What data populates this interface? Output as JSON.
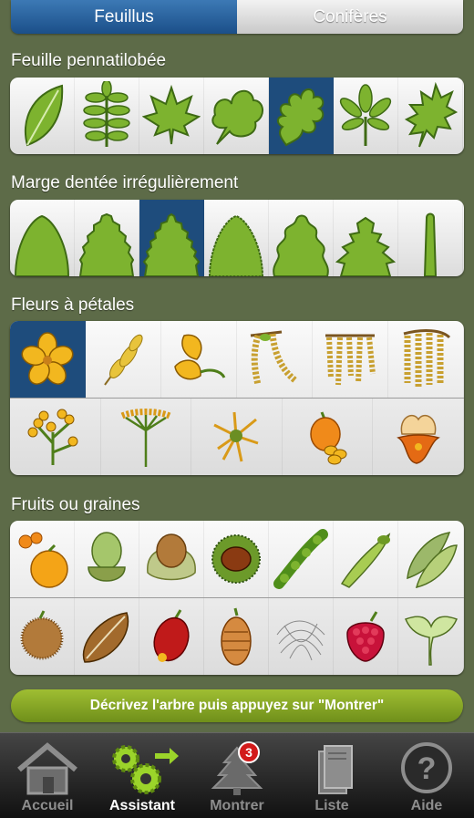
{
  "segments": {
    "left": "Feuillus",
    "right": "Conifères",
    "selected": "Feuillus"
  },
  "sections": [
    {
      "title": "Feuille pennatilobée"
    },
    {
      "title": "Marge dentée irrégulièrement"
    },
    {
      "title": "Fleurs à pétales"
    },
    {
      "title": "Fruits ou graines"
    }
  ],
  "action_button": "Décrivez l'arbre puis appuyez sur \"Montrer\"",
  "tabs": [
    {
      "label": "Accueil"
    },
    {
      "label": "Assistant"
    },
    {
      "label": "Montrer",
      "badge": "3"
    },
    {
      "label": "Liste"
    },
    {
      "label": "Aide"
    }
  ],
  "colors": {
    "leaf": "#7db32f",
    "leaf_dark": "#3e6a14",
    "selected_bg": "#1e4c7c",
    "flower": "#f2b71f",
    "accent_green": "#8bb22a"
  },
  "leaf_shapes": [
    "simple-leaf-icon",
    "pinnate-leaf-icon",
    "maple-leaf-icon",
    "lobed-leaf-icon",
    "oak-leaf-icon",
    "palmate-leaf-icon",
    "pinnatifid-leaf-icon"
  ],
  "margin_shapes": [
    "smooth-margin-icon",
    "serrate-margin-icon",
    "double-serrate-margin-icon",
    "fine-serrate-margin-icon",
    "lobed-margin-icon",
    "spiny-margin-icon",
    "linear-margin-icon"
  ],
  "flower_shapes": [
    "petal-flower-icon",
    "catkin-flower-icon",
    "pea-flower-icon",
    "hanging-catkin-icon",
    "cluster-flower-icon",
    "pendulous-catkin-icon",
    "branched-flower-icon",
    "umbel-flower-icon",
    "spider-flower-icon",
    "orange-flower-icon",
    "fringed-flower-icon"
  ],
  "fruit_shapes": [
    "citrus-fruit-icon",
    "acorn-icon",
    "hazelnut-icon",
    "chestnut-icon",
    "pod-icon",
    "samara-icon",
    "legume-icon",
    "burr-fruit-icon",
    "seed-icon",
    "hip-fruit-icon",
    "cone-fruit-icon",
    "fluffy-seed-icon",
    "berry-icon",
    "capsule-fruit-icon"
  ]
}
